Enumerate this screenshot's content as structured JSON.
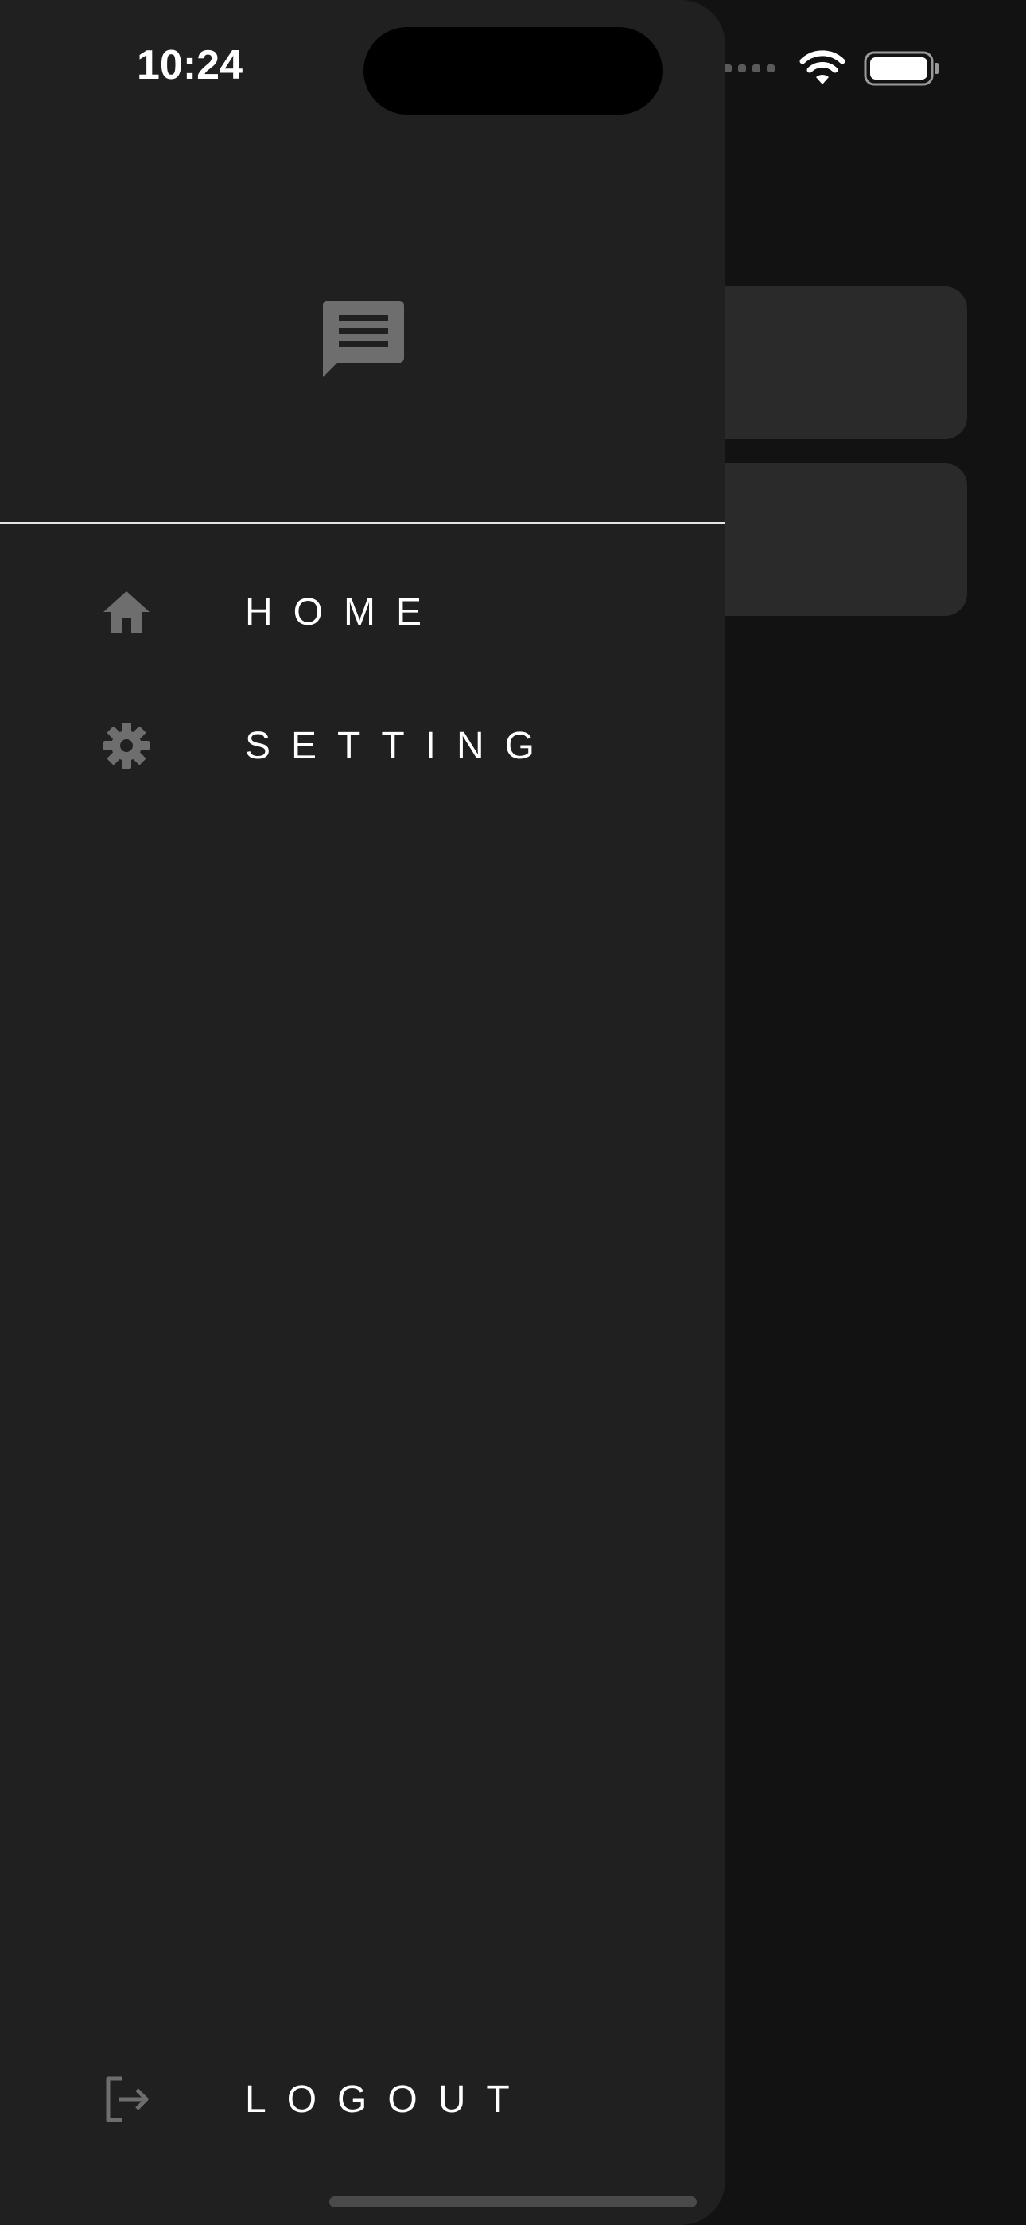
{
  "status_bar": {
    "time": "10:24",
    "icons": [
      "cellular-signal-icon",
      "wifi-icon",
      "battery-icon"
    ]
  },
  "drawer": {
    "header_icon": "message-icon",
    "menu": [
      {
        "label": "HOME",
        "icon": "home-icon"
      },
      {
        "label": "SETTING",
        "icon": "gear-icon"
      }
    ],
    "footer": {
      "label": "LOGOUT",
      "icon": "logout-icon"
    }
  },
  "colors": {
    "drawer_background": "#202020",
    "app_background": "#121212",
    "card_background": "#2a2a2a",
    "icon_gray": "#6e6e6e",
    "text": "#ffffff",
    "divider": "#e6e6e6"
  }
}
